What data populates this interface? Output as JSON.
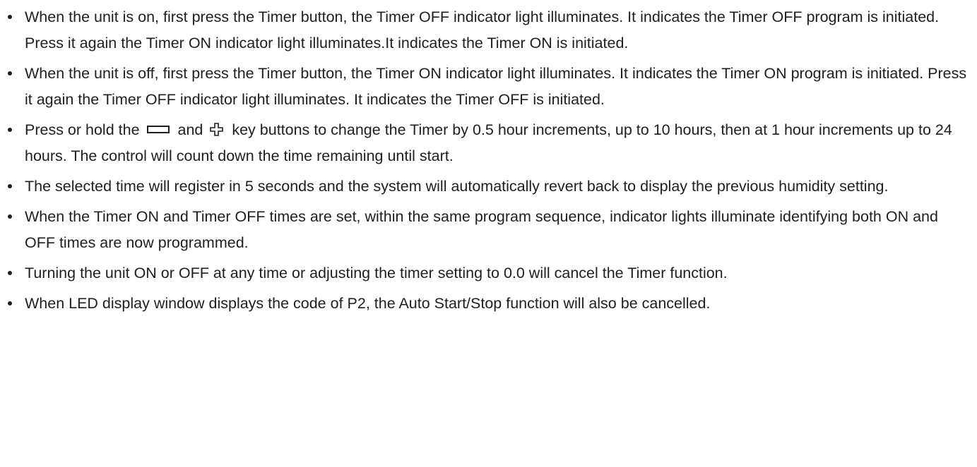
{
  "bullets": [
    {
      "text": "When the unit is on, first press the Timer button, the Timer OFF indicator light illuminates. It indicates the Timer OFF program is initiated. Press it again the Timer ON indicator light illuminates.It indicates the Timer ON is initiated."
    },
    {
      "text": "When the unit is off, first press the Timer button, the Timer ON indicator light illuminates. It indicates the Timer ON program is initiated. Press it again the Timer OFF indicator light illuminates. It indicates the Timer OFF is initiated."
    },
    {
      "text_before": "Press or hold the",
      "text_mid": "and",
      "text_after": "key buttons to change the Timer by 0.5 hour increments, up to 10 hours, then at 1 hour increments up to 24 hours. The control will count down the time remaining until start.",
      "icons": [
        "minus-key-icon",
        "plus-key-icon"
      ]
    },
    {
      "text": "The selected time will register in 5 seconds and the system will automatically revert back to display the previous humidity setting."
    },
    {
      "text": "When the Timer ON and Timer OFF times are set, within the same program sequence, indicator lights illuminate identifying both ON and OFF times are now programmed."
    },
    {
      "text": "Turning the unit ON or OFF at any time or adjusting the timer setting to 0.0 will cancel the Timer function."
    },
    {
      "text": "When LED display window displays the code of P2, the Auto Start/Stop function will also be cancelled."
    }
  ],
  "colors": {
    "text": "#1f1f1f",
    "background": "#ffffff"
  }
}
